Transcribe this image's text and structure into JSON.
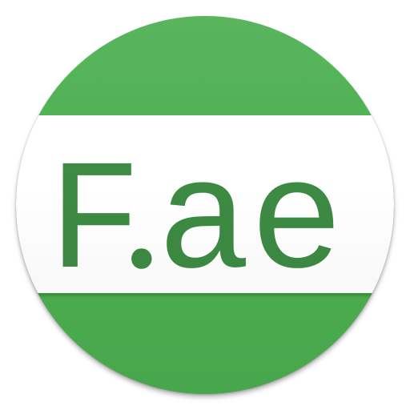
{
  "icon": {
    "label_main": "F",
    "label_dot": ".",
    "label_suffix": "ae",
    "colors": {
      "circle": "#4caf50",
      "band": "#ffffff",
      "text": "#3d8a43"
    }
  }
}
